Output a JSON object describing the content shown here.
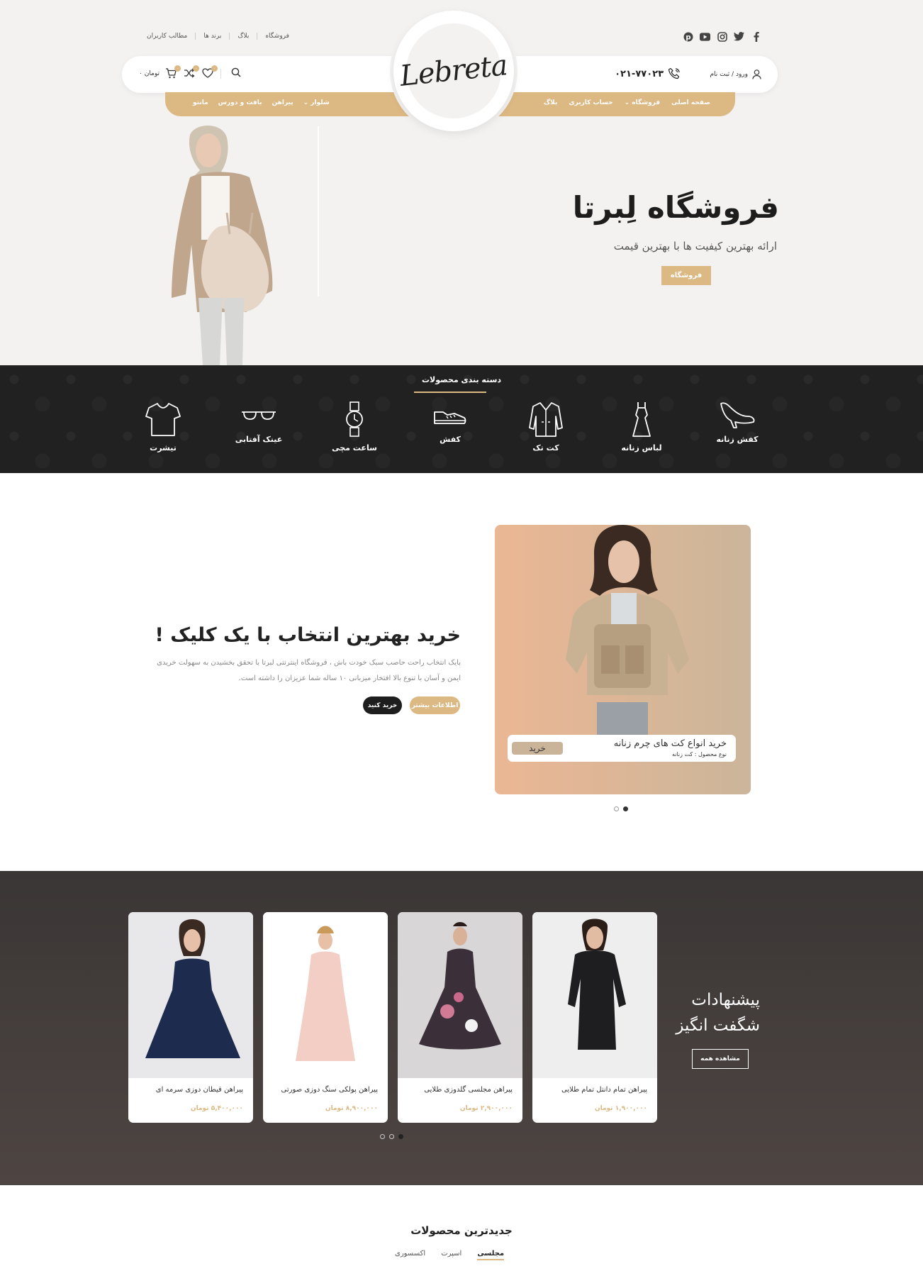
{
  "header": {
    "top_links": [
      "فروشگاه",
      "بلاگ",
      "برند ها",
      "مطالب کاربران"
    ],
    "socials": [
      "facebook-icon",
      "twitter-icon",
      "instagram-icon",
      "youtube-icon",
      "pinterest-icon"
    ],
    "logo": "Lebreta",
    "login_label": "ورود / ثبت نام",
    "phone": "۰۲۱-۷۷۰۲۳",
    "cart_total": "۰ تومان",
    "cart_count": "۰",
    "wishlist_count": "۰",
    "compare_count": "۰",
    "nav_right": [
      "صفحه اصلی",
      "فروشگاه",
      "حساب کاربری",
      "بلاگ"
    ],
    "nav_left": [
      "شلوار",
      "پیراهن",
      "بافت و دورس",
      "مانتو"
    ]
  },
  "hero": {
    "title": "فروشگاه لِبرتا",
    "subtitle": "ارائه بهترین کیفیت ها با بهترین قیمت",
    "button": "فروشگاه"
  },
  "categories": {
    "title": "دسته بندی محصولات",
    "items": [
      {
        "label": "کفش زنانه",
        "icon": "heel-icon"
      },
      {
        "label": "لباس زنانه",
        "icon": "dress-icon"
      },
      {
        "label": "کت تک",
        "icon": "jacket-icon"
      },
      {
        "label": "کفش",
        "icon": "sneaker-icon"
      },
      {
        "label": "ساعت مچی",
        "icon": "watch-icon"
      },
      {
        "label": "عینک آفتابی",
        "icon": "sunglasses-icon"
      },
      {
        "label": "تیشرت",
        "icon": "tshirt-icon"
      }
    ]
  },
  "promo": {
    "title": "خرید بهترین انتخاب با یک کلیک !",
    "desc_line1": "بایک انتخاب راحت حاصب سبک خودت باش ، فروشگاه اینترنتی لبرتا با تحقق بخشیدن به سهولت خریدی",
    "desc_line2": "ایمن و آسان با تنوع بالا افتخار میزبانی ۱۰ ساله شما عزیزان را داشته است.",
    "btn_more": "اطلاعات بیشتر",
    "btn_buy": "خرید کنید",
    "card_name": "خرید انواع کت های چرم زنانه",
    "card_type": "نوع محصول : کت زنانه",
    "card_buy": "خرید"
  },
  "offers": {
    "title_line1": "پیشنهادات",
    "title_line2": "شگفت انگیز",
    "view_all": "مشاهده همه",
    "products": [
      {
        "name": "پیراهن تمام دانتل تمام طلایی",
        "price": "۱,۹۰۰,۰۰۰ تومان"
      },
      {
        "name": "پیراهن مجلسی گلدوزی طلایی",
        "price": "۲,۹۰۰,۰۰۰ تومان"
      },
      {
        "name": "پیراهن پولکی سنگ دوزی صورتی",
        "price": "۸,۹۰۰,۰۰۰ تومان"
      },
      {
        "name": "پیراهن قیطان دوزی سرمه ای",
        "price": "۵,۴۰۰,۰۰۰ تومان"
      }
    ]
  },
  "newest": {
    "title": "جدیدترین محصولات",
    "tabs": [
      "مجلسی",
      "اسپرت",
      "اکسسوری"
    ]
  },
  "colors": {
    "gold": "#dcb883",
    "dark": "#222121",
    "hero_bg": "#f3f2f1"
  }
}
